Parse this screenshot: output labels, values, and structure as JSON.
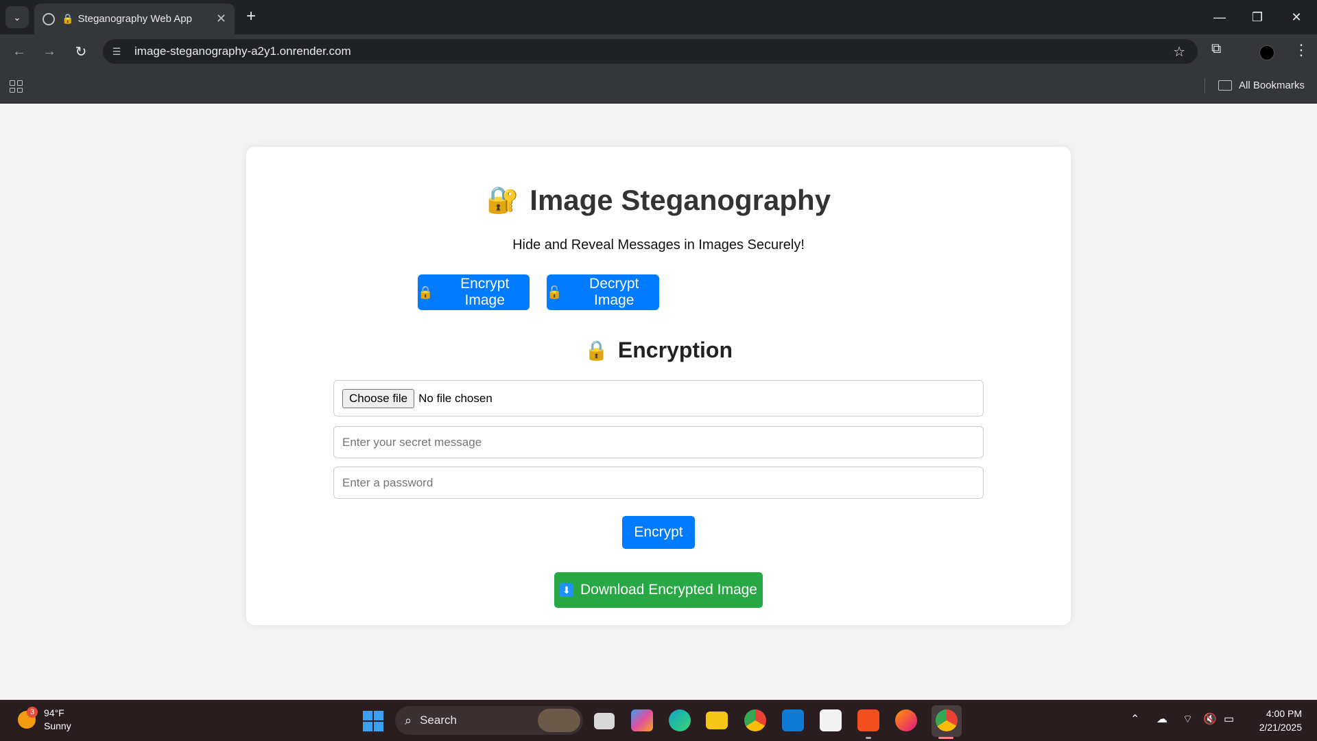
{
  "browser": {
    "tab_title": "Steganography Web App",
    "tab_favicon": "🔒",
    "url": "image-steganography-a2y1.onrender.com",
    "all_bookmarks_label": "All Bookmarks",
    "new_tab_label": "+",
    "tab_close_label": "✕",
    "controls": {
      "minimize": "—",
      "restore": "❐",
      "close": "✕"
    },
    "nav": {
      "back": "←",
      "forward": "→",
      "reload": "↻"
    },
    "star": "☆",
    "menu": "⋮",
    "extensions": "⧉"
  },
  "app": {
    "title_emoji": "🔐",
    "title": "Image Steganography",
    "subtitle": "Hide and Reveal Messages in Images Securely!",
    "encrypt_mode": {
      "emoji": "🔒",
      "label": "Encrypt Image"
    },
    "decrypt_mode": {
      "emoji": "🔓",
      "label": "Decrypt Image"
    },
    "section": {
      "emoji": "🔒",
      "title": "Encryption"
    },
    "file_input": {
      "button_label": "Choose file",
      "status": "No file chosen"
    },
    "message_input": {
      "placeholder": "Enter your secret message",
      "value": ""
    },
    "password_input": {
      "placeholder": "Enter a password",
      "value": ""
    },
    "encrypt_button": "Encrypt",
    "download_button": {
      "emoji": "⬇",
      "label": "Download Encrypted Image"
    },
    "colors": {
      "primary": "#007bff",
      "success": "#28a745",
      "card": "#ffffff",
      "background": "#f4f4f4"
    }
  },
  "taskbar": {
    "weather": {
      "temp": "94°F",
      "condition": "Sunny",
      "badge": "3"
    },
    "search_label": "Search",
    "time": "4:00 PM",
    "date": "2/21/2025",
    "apps": [
      "task-view-icon",
      "copilot-icon",
      "edge-icon",
      "file-explorer-icon",
      "chrome-icon",
      "vscode-icon",
      "store-icon",
      "brave-icon",
      "firefox-icon",
      "chrome-active-icon"
    ]
  }
}
